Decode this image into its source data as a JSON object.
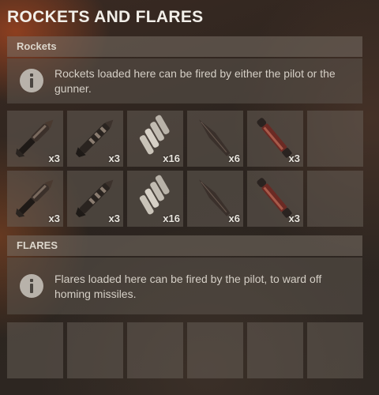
{
  "title": "ROCKETS AND FLARES",
  "rockets": {
    "header": "Rockets",
    "info": "Rockets loaded here can be fired by either the pilot or the gunner.",
    "rows": [
      [
        {
          "icon": "basic-rocket-icon",
          "qty": "x3"
        },
        {
          "icon": "incendiary-rocket-icon",
          "qty": "x3"
        },
        {
          "icon": "smoke-rocket-bundle-icon",
          "qty": "x16"
        },
        {
          "icon": "hv-rocket-icon",
          "qty": "x6"
        },
        {
          "icon": "mlrs-rocket-icon",
          "qty": "x3"
        },
        {
          "icon": "",
          "qty": ""
        }
      ],
      [
        {
          "icon": "basic-rocket-icon",
          "qty": "x3"
        },
        {
          "icon": "incendiary-rocket-icon",
          "qty": "x3"
        },
        {
          "icon": "smoke-rocket-bundle-icon",
          "qty": "x16"
        },
        {
          "icon": "hv-rocket-icon",
          "qty": "x6"
        },
        {
          "icon": "mlrs-rocket-icon",
          "qty": "x3"
        },
        {
          "icon": "",
          "qty": ""
        }
      ]
    ]
  },
  "flares": {
    "header": "FLARES",
    "info": "Flares loaded here can be fired by the pilot, to ward off homing missiles.",
    "slots": [
      "",
      "",
      "",
      "",
      "",
      ""
    ]
  }
}
